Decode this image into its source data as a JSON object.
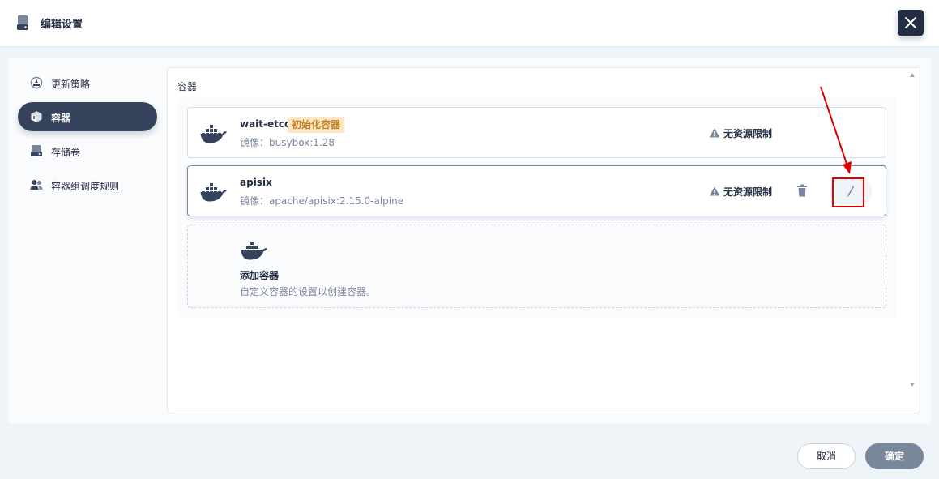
{
  "dialog": {
    "title": "编辑设置",
    "header_icon": "drive-icon",
    "close_icon": "close-icon"
  },
  "sidebar": {
    "items": [
      {
        "label": "更新策略",
        "icon": "update-strategy-icon",
        "active": false
      },
      {
        "label": "容器",
        "icon": "container-box-icon",
        "active": true
      },
      {
        "label": "存储卷",
        "icon": "storage-volume-icon",
        "active": false
      },
      {
        "label": "容器组调度规则",
        "icon": "users-scheduling-icon",
        "active": false
      }
    ]
  },
  "containers": {
    "section_label": "容器",
    "items": [
      {
        "name": "wait-etcd",
        "tag": "初始化容器",
        "image": "镜像：busybox:1.28",
        "resource": "无资源限制"
      },
      {
        "name": "apisix",
        "image": "镜像：apache/apisix:2.15.0-alpine",
        "resource": "无资源限制"
      }
    ],
    "add": {
      "title": "添加容器",
      "description": "自定义容器的设置以创建容器。"
    }
  },
  "footer": {
    "cancel_label": "取消",
    "ok_label": "确定"
  },
  "colors": {
    "primary": "#242e42",
    "active_nav": "#36435c",
    "tag_bg": "#fde6c3",
    "tag_text": "#c17f23",
    "annotation": "#e00000",
    "ok_button": "#79879c"
  }
}
